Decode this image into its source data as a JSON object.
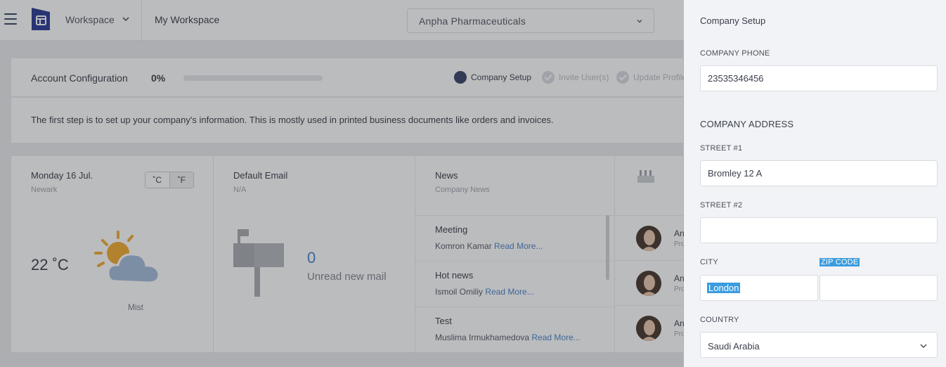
{
  "topbar": {
    "workspace_label": "Workspace",
    "breadcrumb": "My Workspace",
    "company": "Anpha Pharmaceuticals"
  },
  "config": {
    "title": "Account Configuration",
    "percent": "0%",
    "progress_fraction": 0.0,
    "steps": [
      {
        "label": "Company Setup",
        "state": "active"
      },
      {
        "label": "Invite User(s)",
        "state": "todo"
      },
      {
        "label": "Update Profile",
        "state": "todo"
      }
    ]
  },
  "info_text": "The first step is to set up your company's information. This is mostly used in printed business documents like orders and invoices.",
  "weather": {
    "date": "Monday 16 Jul.",
    "location": "Newark",
    "unit_c": "˚C",
    "unit_f": "˚F",
    "temperature": "22 ˚C",
    "condition": "Mist"
  },
  "email": {
    "title": "Default Email",
    "address": "N/A",
    "count": "0",
    "label": "Unread new mail"
  },
  "news": {
    "title": "News",
    "subtitle": "Company News",
    "read_more": "Read More...",
    "items": [
      {
        "title": "Meeting",
        "author": "Komron Kamar"
      },
      {
        "title": "Hot news",
        "author": "Ismoil Omiliy"
      },
      {
        "title": "Test",
        "author": "Muslima Irmukhamedova"
      }
    ]
  },
  "people": [
    {
      "name": "An",
      "role": "Pro"
    },
    {
      "name": "An",
      "role": "Pro"
    },
    {
      "name": "An",
      "role": "Pro"
    }
  ],
  "panel": {
    "title": "Company Setup",
    "phone_label": "COMPANY PHONE",
    "phone_value": "23535346456",
    "address_heading": "COMPANY ADDRESS",
    "street1_label": "STREET #1",
    "street1_value": "Bromley 12 A",
    "street2_label": "STREET #2",
    "street2_value": "",
    "city_label": "CITY",
    "city_value": "London",
    "zip_label": "ZIP CODE",
    "zip_value": "",
    "country_label": "COUNTRY",
    "country_value": "Saudi Arabia"
  },
  "colors": {
    "brand": "#2b3960",
    "link": "#3f7bc7",
    "selection": "#3b9cde",
    "panel_bg": "#f2f3f6"
  }
}
